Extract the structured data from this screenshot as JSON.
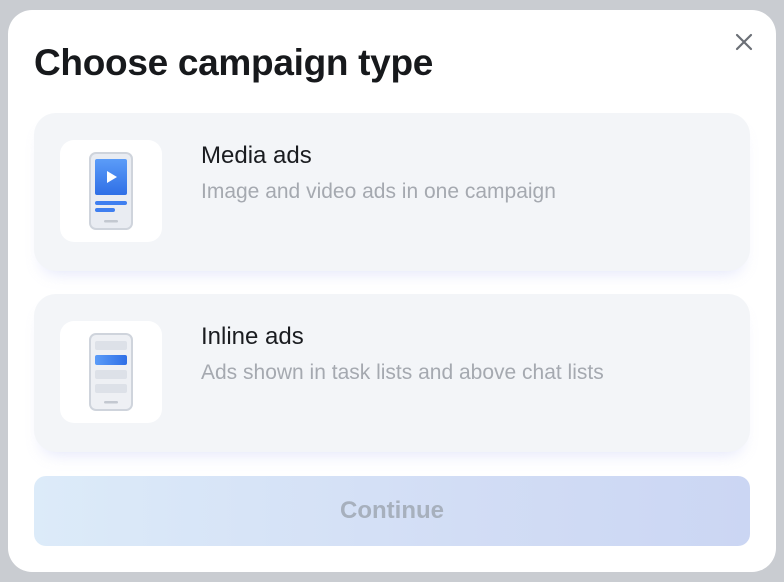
{
  "modal": {
    "title": "Choose campaign type",
    "close_icon": "close-icon",
    "options": [
      {
        "title": "Media ads",
        "description": "Image and video ads in one campaign",
        "icon": "media-ads-phone-icon"
      },
      {
        "title": "Inline ads",
        "description": "Ads shown in task lists and above chat lists",
        "icon": "inline-ads-phone-icon"
      }
    ],
    "continue_label": "Continue"
  },
  "colors": {
    "accent_blue": "#3b82f6",
    "card_bg": "#f3f5f8",
    "muted_text": "#a5a9b0",
    "continue_text": "#a7b0bd"
  }
}
